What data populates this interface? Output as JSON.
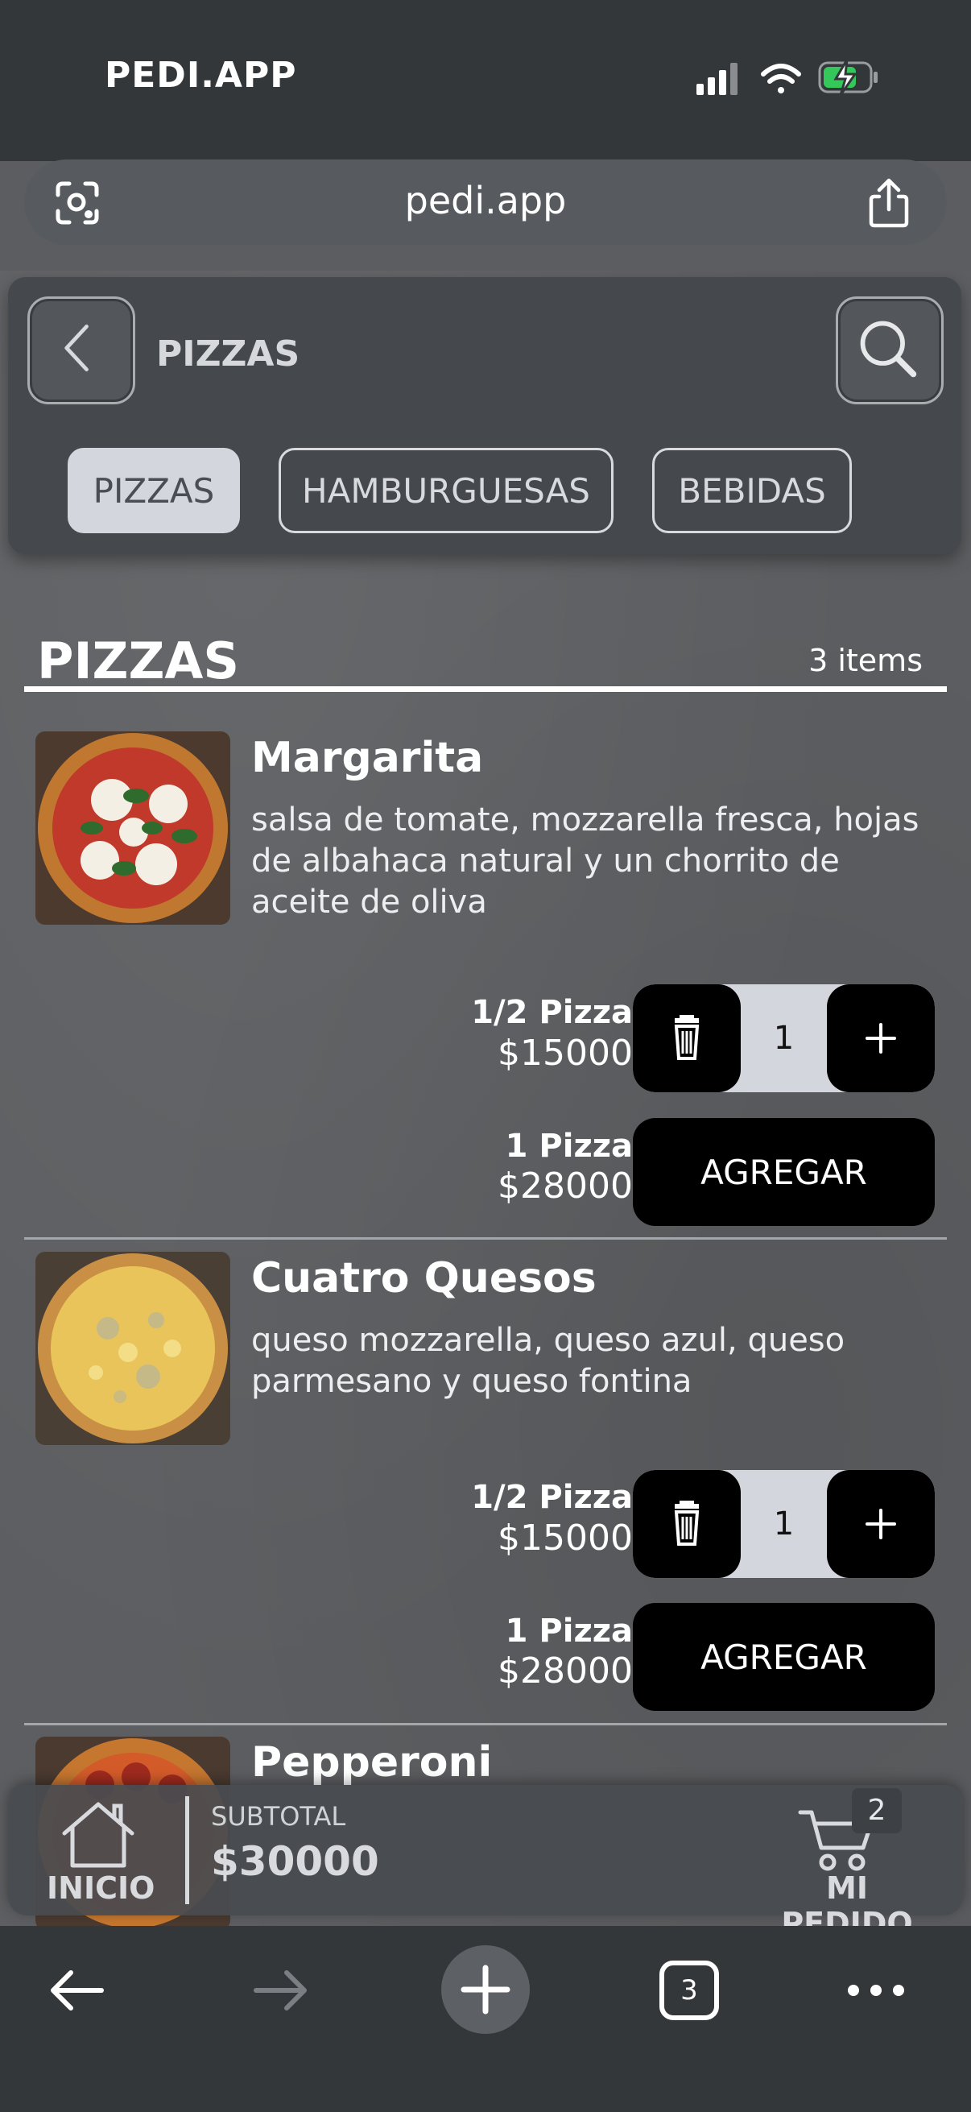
{
  "status_bar": {
    "carrier": "PEDI.APP",
    "icons": [
      "signal-icon",
      "wifi-icon",
      "battery-charging-icon"
    ]
  },
  "url_bar": {
    "url": "pedi.app",
    "icons": [
      "visual-lookup-icon",
      "share-icon"
    ]
  },
  "header": {
    "title": "PIZZAS",
    "icons": [
      "chevron-left-icon",
      "search-icon"
    ],
    "categories": [
      {
        "label": "PIZZAS",
        "selected": true
      },
      {
        "label": "HAMBURGUESAS",
        "selected": false
      },
      {
        "label": "BEBIDAS",
        "selected": false
      }
    ]
  },
  "section": {
    "title": "PIZZAS",
    "count": "3 items"
  },
  "products": [
    {
      "name": "Margarita",
      "description": "salsa de tomate, mozzarella fresca, hojas de albahaca natural y un chorrito de aceite de oliva",
      "options": [
        {
          "name": "1/2 Pizza",
          "price": "$15000",
          "quantity": "1"
        },
        {
          "name": "1 Pizza",
          "price": "$28000",
          "button": "AGREGAR"
        }
      ]
    },
    {
      "name": "Cuatro Quesos",
      "description": "queso mozzarella, queso azul, queso parmesano y queso fontina",
      "options": [
        {
          "name": "1/2 Pizza",
          "price": "$15000",
          "quantity": "1"
        },
        {
          "name": "1 Pizza",
          "price": "$28000",
          "button": "AGREGAR"
        }
      ]
    },
    {
      "name": "Pepperoni"
    }
  ],
  "order_bar": {
    "home_label": "INICIO",
    "subtotal_label": "SUBTOTAL",
    "subtotal_value": "$30000",
    "cart_badge": "2",
    "cart_label": "MI PEDIDO",
    "icons": [
      "home-icon",
      "cart-icon"
    ]
  },
  "browser_toolbar": {
    "tabs_count": "3",
    "icons": [
      "back-arrow-icon",
      "forward-arrow-icon",
      "new-tab-icon",
      "tabs-icon",
      "more-icon"
    ]
  },
  "colors": {
    "chrome": "#34373a",
    "page_bg": "#5c5e61",
    "selected_chip": "#d3d6dc",
    "button": "#000000"
  }
}
